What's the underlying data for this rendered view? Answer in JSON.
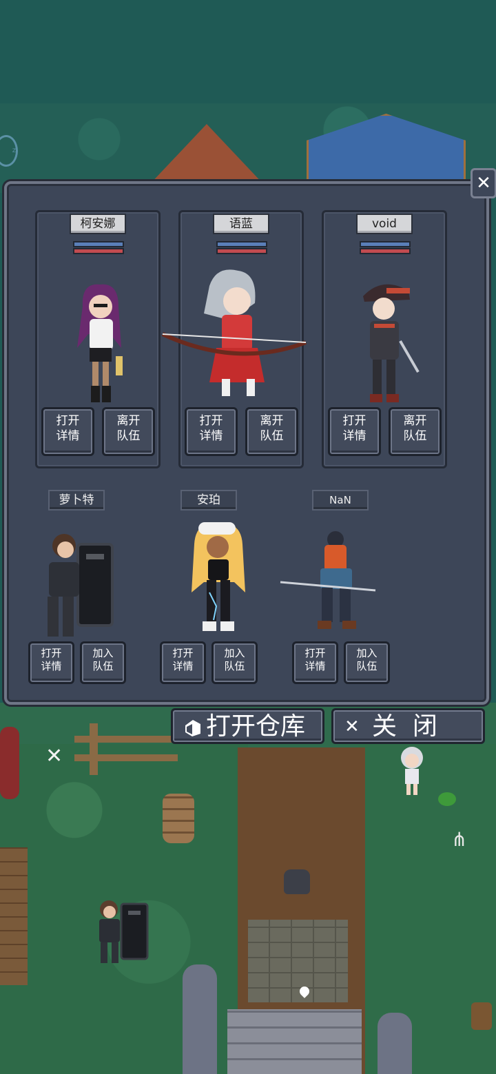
{
  "party": {
    "members": [
      {
        "name": "柯安娜",
        "details_label": "打开\n详情",
        "action_label": "离开\n队伍"
      },
      {
        "name": "语蓝",
        "details_label": "打开\n详情",
        "action_label": "离开\n队伍"
      },
      {
        "name": "void",
        "details_label": "打开\n详情",
        "action_label": "离开\n队伍"
      }
    ]
  },
  "reserve": {
    "members": [
      {
        "name": "萝卜特",
        "details_label": "打开\n详情",
        "action_label": "加入\n队伍"
      },
      {
        "name": "安珀",
        "details_label": "打开\n详情",
        "action_label": "加入\n队伍"
      },
      {
        "name": "NaN",
        "details_label": "打开\n详情",
        "action_label": "加入\n队伍"
      }
    ]
  },
  "footer": {
    "warehouse_label": "打开仓库",
    "close_label": "关  闭",
    "warehouse_icon": "crate-icon",
    "close_icon": "x-icon"
  },
  "colors": {
    "panel": "#3d4658",
    "hp": "#c24b50",
    "mp": "#5a7fb8"
  }
}
